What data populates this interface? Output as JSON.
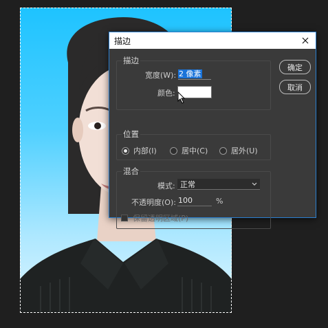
{
  "dialog": {
    "title": "描边",
    "close_icon": "close-icon",
    "stroke_group": {
      "title": "描边",
      "width_label": "宽度(W):",
      "width_value": "2 像素",
      "color_label": "颜色:",
      "color_value": "#ffffff"
    },
    "position_group": {
      "title": "位置",
      "options": [
        {
          "label": "内部(I)",
          "checked": true
        },
        {
          "label": "居中(C)",
          "checked": false
        },
        {
          "label": "居外(U)",
          "checked": false
        }
      ]
    },
    "blend_group": {
      "title": "混合",
      "mode_label": "模式:",
      "mode_value": "正常",
      "opacity_label": "不透明度(O):",
      "opacity_value": "100",
      "opacity_unit": "%",
      "preserve_label": "保留透明区域(P)",
      "preserve_checked": false
    },
    "buttons": {
      "ok": "确定",
      "cancel": "取消"
    }
  },
  "colors": {
    "dialog_bg": "#3a3a3a",
    "accent": "#1a73d9",
    "photo_background": "#1ec3ff",
    "app_bg": "#1f1f1f"
  }
}
